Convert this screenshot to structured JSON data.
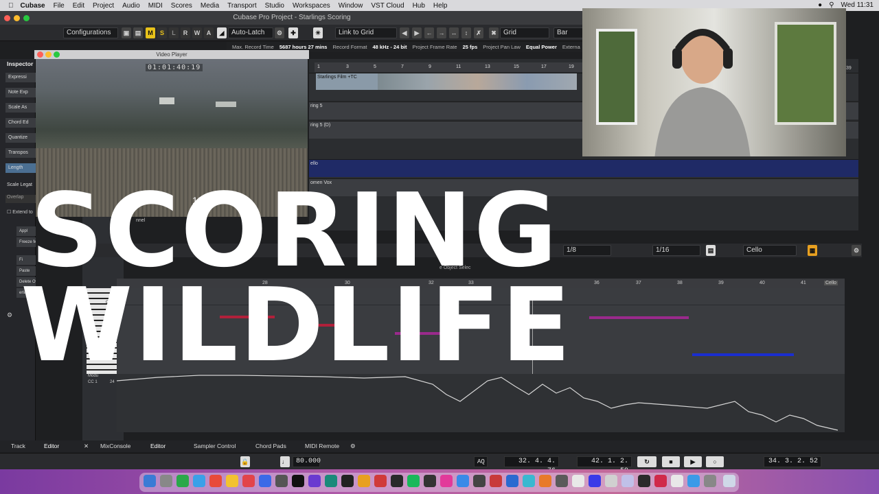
{
  "menubar": {
    "app": "Cubase",
    "items": [
      "File",
      "Edit",
      "Project",
      "Audio",
      "MIDI",
      "Scores",
      "Media",
      "Transport",
      "Studio",
      "Workspaces",
      "Window",
      "VST Cloud",
      "Hub",
      "Help"
    ],
    "clock": "Wed  11:31"
  },
  "window": {
    "title": "Cubase Pro Project - Starlings Scoring"
  },
  "toolbar": {
    "configurations": "Configurations",
    "m": "M",
    "s": "S",
    "l": "L",
    "r": "R",
    "w": "W",
    "a": "A",
    "automation_mode": "Auto-Latch",
    "snap_mode": "Link to Grid",
    "grid": "Grid",
    "bar": "Bar"
  },
  "infoline": {
    "max_record_label": "Max. Record Time",
    "max_record_value": "5687 hours 27 mins",
    "record_format_label": "Record Format",
    "record_format_value": "48 kHz - 24 bit",
    "frame_rate_label": "Project Frame Rate",
    "frame_rate_value": "25 fps",
    "pan_law_label": "Project Pan Law",
    "pan_law_value": "Equal Power",
    "external": "Externa"
  },
  "inspector": {
    "title": "Inspector",
    "items": [
      "Expressi",
      "Note Exp",
      "Scale As",
      "Chord Ed",
      "Quantize",
      "Transpos",
      "Length"
    ],
    "scale_legato": "Scale Legat",
    "overlap": "Overlap",
    "extend": "Extend to",
    "apply": "Appl",
    "freeze": "Freeze MIDI Leng",
    "fixed": "Fi",
    "paste": "Paste",
    "delete_overlaps": "Delete Overlaps (mono",
    "overlaps_poly": "erlaps (p"
  },
  "video": {
    "title": "Video Player",
    "timecode": "01:01:40:19",
    "timecode_partial": "19"
  },
  "arrange": {
    "ruler": [
      "1",
      "3",
      "5",
      "7",
      "9",
      "11",
      "13",
      "15",
      "17",
      "19"
    ],
    "ruler_right": "39",
    "tracks": [
      "Starlings Film +TC",
      "ring 5",
      "ring 5 (D)",
      "ello",
      "omen Vox"
    ]
  },
  "editor": {
    "quantize": "1/8",
    "length": "1/16",
    "track": "Cello",
    "object_select": "e Object Selec",
    "channel": "nnel",
    "ruler": [
      "28",
      "30",
      "32",
      "33",
      "36",
      "37",
      "38",
      "39",
      "40",
      "41"
    ],
    "cello_label": "Cello",
    "cc_label": "Modu",
    "cc_number": "CC 1",
    "cc_value": "24",
    "note_label": "C3"
  },
  "bottomtabs": {
    "track": "Track",
    "editor_left": "Editor",
    "mixconsole": "MixConsole",
    "editor": "Editor",
    "sampler": "Sampler Control",
    "chordpads": "Chord Pads",
    "midiremote": "MIDI Remote"
  },
  "transport": {
    "tempo": "80.000",
    "left_locator": "32. 4. 4. 76",
    "right_locator": "42. 1. 2. 59",
    "position": "34. 3. 2. 52",
    "aq": "AQ"
  },
  "overlay": {
    "line1": "SCORING",
    "line2": "WILDLIFE"
  },
  "colors": {
    "accent_yellow": "#e8c21a",
    "note_red": "#b0203a",
    "note_purple": "#9a2a8c",
    "note_blue": "#1a2ed0"
  }
}
